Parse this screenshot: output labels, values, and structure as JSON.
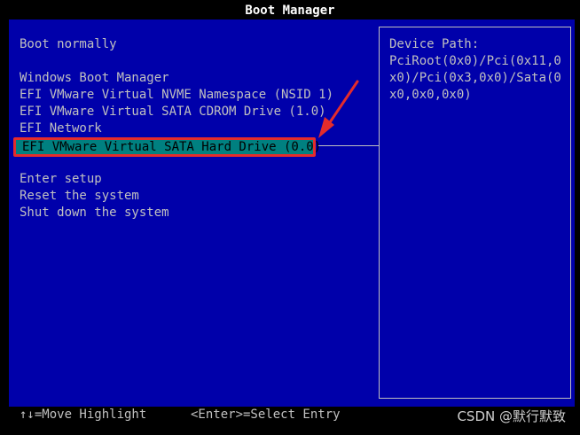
{
  "window": {
    "title": "Boot Manager"
  },
  "menu": {
    "items": [
      {
        "label": "Boot normally"
      },
      {
        "label": "Windows Boot Manager"
      },
      {
        "label": "EFI VMware Virtual NVME Namespace (NSID 1)"
      },
      {
        "label": "EFI VMware Virtual SATA CDROM Drive (1.0)"
      },
      {
        "label": "EFI Network"
      },
      {
        "label": "EFI VMware Virtual SATA Hard Drive (0.0)",
        "selected": true
      },
      {
        "label": "Enter setup"
      },
      {
        "label": "Reset the system"
      },
      {
        "label": "Shut down the system"
      }
    ]
  },
  "info": {
    "title": "Device Path:",
    "value": "PciRoot(0x0)/Pci(0x11,0x0)/Pci(0x3,0x0)/Sata(0x0,0x0,0x0)"
  },
  "footer": {
    "move_hint": "↑↓=Move Highlight",
    "enter_hint": "<Enter>=Select Entry",
    "watermark": "CSDN @默行默致"
  },
  "colors": {
    "background": "#0000aa",
    "text": "#c0c0c0",
    "highlight": "#008080",
    "annotation": "#e32c2c"
  },
  "icons": {
    "annotation_arrow": "red-arrow-icon"
  }
}
